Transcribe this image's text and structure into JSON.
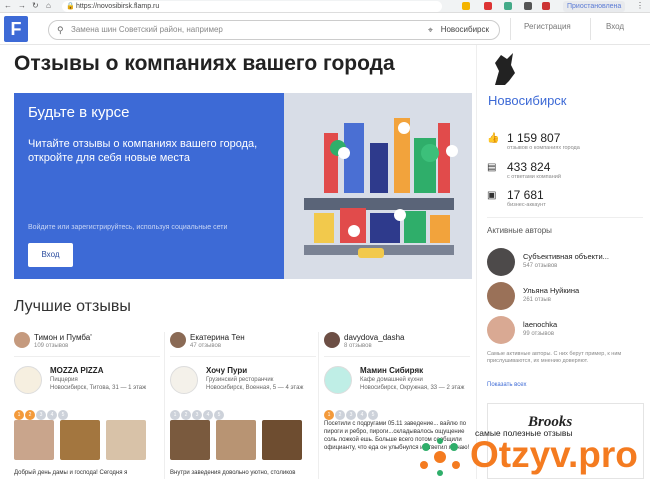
{
  "browser": {
    "url": "https://novosibirsk.flamp.ru",
    "user": "Приостановлена"
  },
  "header": {
    "logo": "F",
    "search_placeholder": "Замена шин Советский район, например",
    "city": "Новосибирск",
    "register": "Регистрация",
    "login": "Вход"
  },
  "page_title": "Отзывы о компаниях вашего города",
  "banner": {
    "heading": "Будьте в курсе",
    "text": "Читайте отзывы о компаниях вашего города, откройте для себя новые места",
    "small": "Войдите или зарегистрируйтесь, используя социальные сети",
    "login_button": "Вход"
  },
  "best_title": "Лучшие отзывы",
  "reviews": [
    {
      "author": "Тимон и Пумба'",
      "count": "109 отзывов",
      "company": "MOZZA PIZZA",
      "type": "Пиццерия",
      "address": "Новосибирск, Титова, 31 — 1 этаж",
      "text": "Добрый день дамы и господа! Сегодня я"
    },
    {
      "author": "Екатерина Тен",
      "count": "47 отзывов",
      "company": "Хочу Пури",
      "type": "Грузинский ресторанчик",
      "address": "Новосибирск, Военная, 5 — 4 этаж",
      "text": "Внутри заведения довольно уютно, столиков"
    },
    {
      "author": "davydova_dasha",
      "count": "8 отзывов",
      "company": "Мамин Сибиряк",
      "type": "Кафе домашней кухни",
      "address": "Новосибирск, Окружная, 33 — 2 этаж",
      "text": "Посетили с подругами 05.11 заведение... вайлю по пироги и ребро, пироги...складывалось ощущение соль ложкой ешь. Больше всего потом сообщили официанту, что еда он улыбнулся и ответил я знаю!"
    }
  ],
  "stars": [
    "1",
    "2",
    "3",
    "4",
    "5"
  ],
  "sidebar": {
    "city": "Новосибирск",
    "stats": [
      {
        "icon": "thumbs-icon",
        "value": "1 159 807",
        "label": "отзывов о компаниях города"
      },
      {
        "icon": "comment-icon",
        "value": "433 824",
        "label": "с ответами компаний"
      },
      {
        "icon": "briefcase-icon",
        "value": "17 681",
        "label": "бизнес-аккаунт"
      }
    ],
    "active_title": "Активные авторы",
    "authors": [
      {
        "name": "Субъективная объекти...",
        "count": "547 отзывов"
      },
      {
        "name": "Ульяна Нуйкина",
        "count": "261 отзыв"
      },
      {
        "name": "laenochka",
        "count": "99 отзывов"
      }
    ],
    "note": "Самые активные авторы. С них берут пример, к ним прислушиваются, их мнению доверяют.",
    "show_all": "Показать всех",
    "ad_brand": "Brooks"
  },
  "watermark": {
    "tagline": "самые полезные отзывы",
    "brand": "Otzyv.pro"
  },
  "colors": {
    "accent": "#3d6ad6",
    "star_on": "#f39a3b",
    "otzyv": "#f47b20"
  }
}
